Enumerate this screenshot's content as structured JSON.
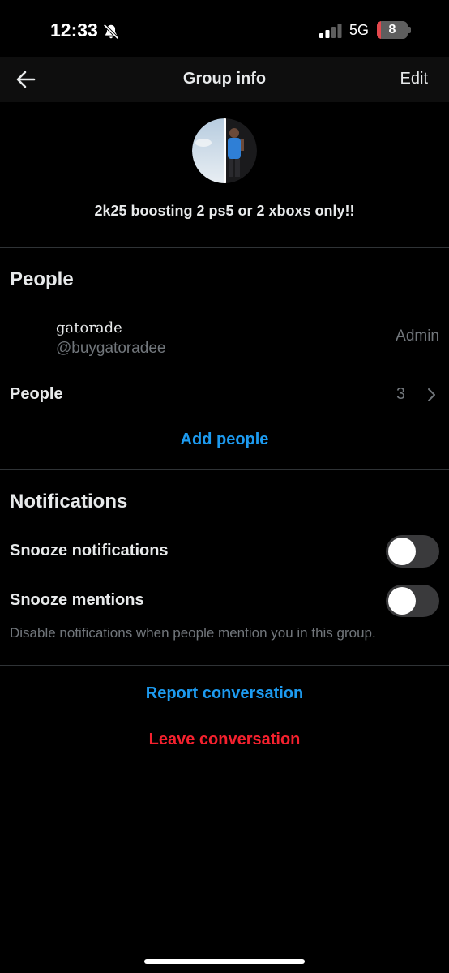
{
  "status_bar": {
    "time": "12:33",
    "network": "5G",
    "battery": "8",
    "battery_level": 0.08,
    "icons": [
      "bell-slash-icon",
      "signal-icon",
      "battery-icon"
    ]
  },
  "nav": {
    "title": "Group info",
    "back_icon": "arrow-left-icon",
    "edit_label": "Edit"
  },
  "group": {
    "name": "2k25 boosting 2 ps5 or 2 xboxs only!!"
  },
  "people_section": {
    "heading": "People",
    "member": {
      "name": "gatorade",
      "handle": "@buygatoradee",
      "role": "Admin"
    },
    "people_row_label": "People",
    "people_count": "3",
    "chevron_icon": "chevron-right-icon",
    "add_people_label": "Add people"
  },
  "notifications_section": {
    "heading": "Notifications",
    "snooze_notifications_label": "Snooze notifications",
    "snooze_notifications_on": false,
    "snooze_mentions_label": "Snooze mentions",
    "snooze_mentions_on": false,
    "mentions_helper": "Disable notifications when people mention you in this group."
  },
  "actions": {
    "report_label": "Report conversation",
    "leave_label": "Leave conversation"
  },
  "colors": {
    "background": "#000000",
    "link_blue": "#1d9bf0",
    "danger_red": "#f4212e",
    "secondary_text": "#71767b"
  }
}
